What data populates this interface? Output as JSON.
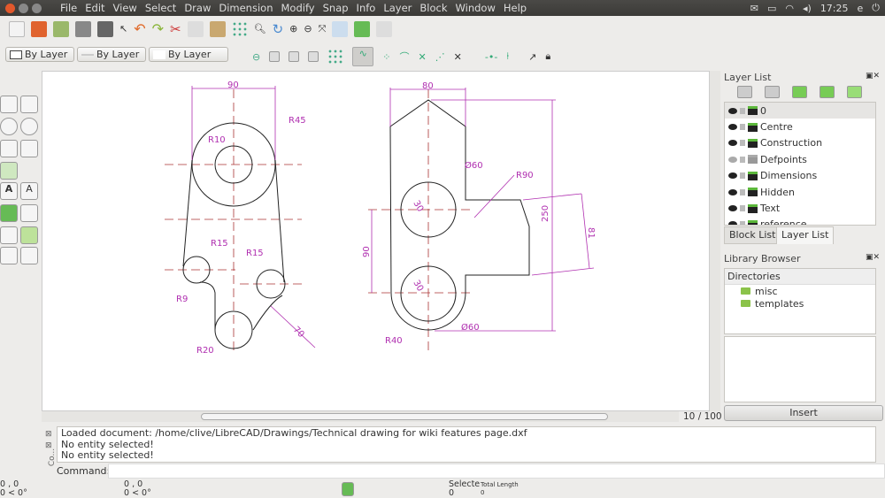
{
  "menubar": {
    "items": [
      "File",
      "Edit",
      "View",
      "Select",
      "Draw",
      "Dimension",
      "Modify",
      "Snap",
      "Info",
      "Layer",
      "Block",
      "Window",
      "Help"
    ],
    "clock": "17:25",
    "user": "e"
  },
  "pen_toolbar": {
    "color": "By Layer",
    "width": "By Layer",
    "type": "By Layer"
  },
  "drawing": {
    "left": {
      "width_dim": "90",
      "r_top": "R45",
      "r_inner": "R10",
      "r_left": "R15",
      "r_right": "R15",
      "r_fillet": "R9",
      "r_bottom": "R20",
      "len": "70"
    },
    "right": {
      "width_dim": "80",
      "dia_top": "Ø60",
      "r_arc": "R90",
      "r_top_hole": "30",
      "height": "250",
      "side": "81",
      "spacing": "90",
      "r_bot_hole": "30",
      "dia_bot": "Ø60",
      "r_base": "R40"
    }
  },
  "page_indicator": "10 / 100",
  "layer_list": {
    "title": "Layer List",
    "layers": [
      {
        "name": "0",
        "visible": true
      },
      {
        "name": "Centre",
        "visible": true
      },
      {
        "name": "Construction",
        "visible": true
      },
      {
        "name": "Defpoints",
        "visible": false
      },
      {
        "name": "Dimensions",
        "visible": true
      },
      {
        "name": "Hidden",
        "visible": true
      },
      {
        "name": "Text",
        "visible": true
      },
      {
        "name": "reference",
        "visible": true
      }
    ]
  },
  "tabs": {
    "block": "Block List",
    "layer": "Layer List"
  },
  "library": {
    "title": "Library Browser",
    "header": "Directories",
    "dirs": [
      "misc",
      "templates"
    ],
    "insert": "Insert"
  },
  "console": {
    "lines": [
      "Loaded document: /home/clive/LibreCAD/Drawings/Technical drawing for wiki features page.dxf",
      "No entity selected!",
      "No entity selected!"
    ],
    "label": "Command:",
    "dock_label": "Co..."
  },
  "status": {
    "abs_coord": "0 , 0",
    "abs_polar": "0 < 0°",
    "rel_coord": "0 , 0",
    "rel_polar": "0 < 0°",
    "selected_label": "Selecte",
    "selected": "0",
    "total_length_label": "Total Length",
    "total_length": "0"
  }
}
